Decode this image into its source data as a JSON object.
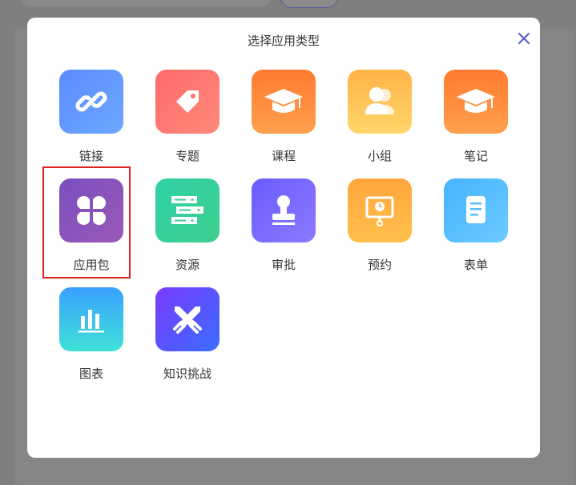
{
  "modal": {
    "title": "选择应用类型",
    "close_icon": "close-icon"
  },
  "colors": {
    "selection_border": "#e02020",
    "accent": "#5c63c7"
  },
  "app_types": [
    {
      "id": "link",
      "label": "链接",
      "icon": "link-icon",
      "gradient": [
        "#5a8cff",
        "#6ea8ff"
      ]
    },
    {
      "id": "topic",
      "label": "专题",
      "icon": "tag-icon",
      "gradient": [
        "#ff6a6a",
        "#ff8a7a"
      ]
    },
    {
      "id": "course",
      "label": "课程",
      "icon": "graduation-cap-icon",
      "gradient": [
        "#ff7a2e",
        "#ffa04e"
      ]
    },
    {
      "id": "group",
      "label": "小组",
      "icon": "group-icon",
      "gradient": [
        "#ffb347",
        "#ffd66b"
      ]
    },
    {
      "id": "note",
      "label": "笔记",
      "icon": "graduation-cap-icon",
      "gradient": [
        "#ff7a2e",
        "#ffa04e"
      ]
    },
    {
      "id": "app-package",
      "label": "应用包",
      "icon": "clover-icon",
      "gradient": [
        "#7a4fbf",
        "#9b59b6"
      ],
      "selected": true
    },
    {
      "id": "resource",
      "label": "资源",
      "icon": "server-icon",
      "gradient": [
        "#2fd1a8",
        "#3ecf8e"
      ]
    },
    {
      "id": "approval",
      "label": "审批",
      "icon": "stamp-icon",
      "gradient": [
        "#6a5cff",
        "#8b7bff"
      ]
    },
    {
      "id": "appointment",
      "label": "预约",
      "icon": "presentation-clock-icon",
      "gradient": [
        "#ffa63d",
        "#ffc04d"
      ]
    },
    {
      "id": "form",
      "label": "表单",
      "icon": "document-icon",
      "gradient": [
        "#46b4ff",
        "#6ccaff"
      ]
    },
    {
      "id": "chart",
      "label": "图表",
      "icon": "bar-chart-icon",
      "gradient": [
        "#3aa0ff",
        "#3ee2d8"
      ]
    },
    {
      "id": "knowledge-challenge",
      "label": "知识挑战",
      "icon": "crossed-swords-icon",
      "gradient": [
        "#7a3cff",
        "#3a6cff"
      ]
    }
  ]
}
